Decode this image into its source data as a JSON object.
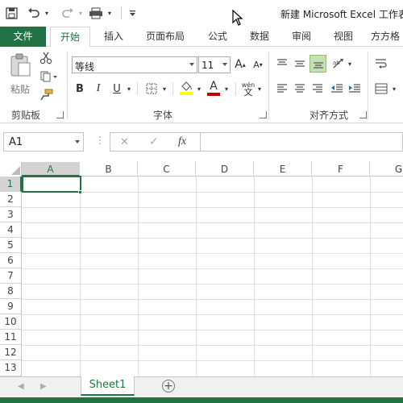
{
  "title": "新建 Microsoft Excel 工作表",
  "tabs": [
    "文件",
    "开始",
    "插入",
    "页面布局",
    "公式",
    "数据",
    "审阅",
    "视图",
    "方方格"
  ],
  "clipboard": {
    "paste_label": "粘贴",
    "group_label": "剪贴板"
  },
  "font": {
    "name": "等线",
    "size": "11",
    "group_label": "字体",
    "bold": "B",
    "italic": "I",
    "underline": "U",
    "grow": "A",
    "shrink": "A",
    "color_a": "A",
    "wen": "wén"
  },
  "alignment": {
    "group_label": "对齐方式"
  },
  "formula_bar": {
    "name_box": "A1",
    "fx": "fx",
    "cancel": "✕",
    "enter": "✓",
    "formula": ""
  },
  "columns": [
    "A",
    "B",
    "C",
    "D",
    "E",
    "F",
    "G"
  ],
  "rows": [
    "1",
    "2",
    "3",
    "4",
    "5",
    "6",
    "7",
    "8",
    "9",
    "10",
    "11",
    "12",
    "13"
  ],
  "selected_cell": "A1",
  "sheets": {
    "active": "Sheet1",
    "add": "+"
  },
  "colors": {
    "accent": "#217346",
    "highlight": "#c6e0b4",
    "font_color": "#c00000",
    "fill_color": "#ffff00"
  }
}
